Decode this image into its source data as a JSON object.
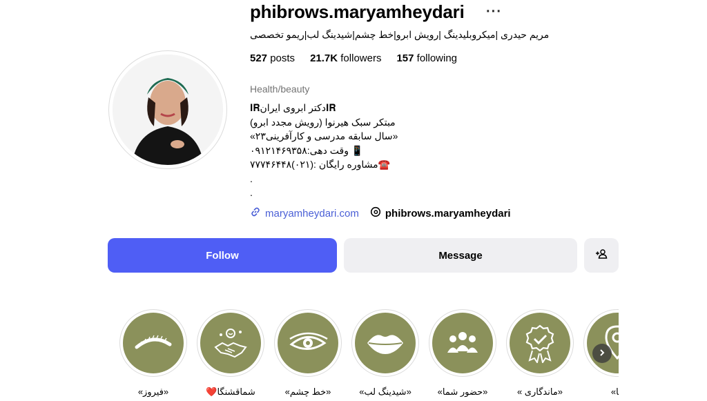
{
  "profile": {
    "username": "phibrows.maryamheydari",
    "more_label": "···",
    "full_name": "مریم حیدری |میکروبلیدینگ |رویش ابرو|خط چشم|شیدینگ لب|ریمو تخصصی",
    "stats": {
      "posts_count": "527",
      "posts_label": "posts",
      "followers_count": "21.7K",
      "followers_label": "followers",
      "following_count": "157",
      "following_label": "following"
    },
    "category": "Health/beauty",
    "bio_lines": [
      "𝐈𝐑دکتر ابروی ایران𝐈𝐑",
      "مبتکر سبک هیرنوا (رویش مجدد ابرو)",
      "«سال سابقه مدرسی و کارآفرینی۲۳»",
      "📱 وقت دهی:۰۹۱۲۱۴۶۹۳۵۸",
      "☎️مشاوره رایگان :(۰۲۱)۷۷۷۴۶۴۴۸",
      ".",
      "."
    ],
    "website": "maryamheydari.com",
    "threads_handle": "phibrows.maryamheydari"
  },
  "actions": {
    "follow_label": "Follow",
    "message_label": "Message",
    "follow_color": "#4f5ef5"
  },
  "highlights": [
    {
      "label": "«فیروز»",
      "icon": "eyebrow-icon"
    },
    {
      "label": "شماقشنگا❤️",
      "icon": "handshake-icon"
    },
    {
      "label": "«خط چشم»",
      "icon": "eye-icon"
    },
    {
      "label": "«شیدینگ لب»",
      "icon": "lips-icon"
    },
    {
      "label": "«حضور شما»",
      "icon": "group-icon"
    },
    {
      "label": "«ماندگاری »",
      "icon": "award-badge-icon"
    },
    {
      "label": "ما»",
      "icon": "location-pin-icon"
    }
  ],
  "theme": {
    "highlight_color": "#8b915b"
  }
}
